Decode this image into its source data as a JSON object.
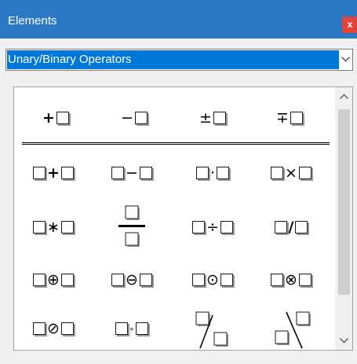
{
  "window": {
    "title": "Elements",
    "close_label": "x"
  },
  "category": {
    "selected": "Unary/Binary Operators"
  },
  "icons": {
    "close": "close-icon",
    "dropdown": "chevron-down-icon",
    "scroll_up": "chevron-up-icon",
    "scroll_down": "chevron-down-icon"
  },
  "colors": {
    "titlebar": "#2b78c5",
    "selection": "#0078d7",
    "close": "#e0443a"
  },
  "elements": {
    "row1": {
      "plus": "+",
      "minus": "−",
      "plusminus": "±",
      "minusplus": "∓"
    },
    "row2": {
      "plus": "+",
      "minus": "−",
      "cdot": "·",
      "times": "×"
    },
    "row3": {
      "ast": "∗",
      "div": "÷",
      "slash": "/"
    },
    "row4": {
      "oplus": "⊕",
      "ominus": "⊖",
      "odot": "⊙",
      "otimes": "⊗"
    },
    "row5": {
      "oslash": "⊘",
      "circ": "∘"
    }
  }
}
